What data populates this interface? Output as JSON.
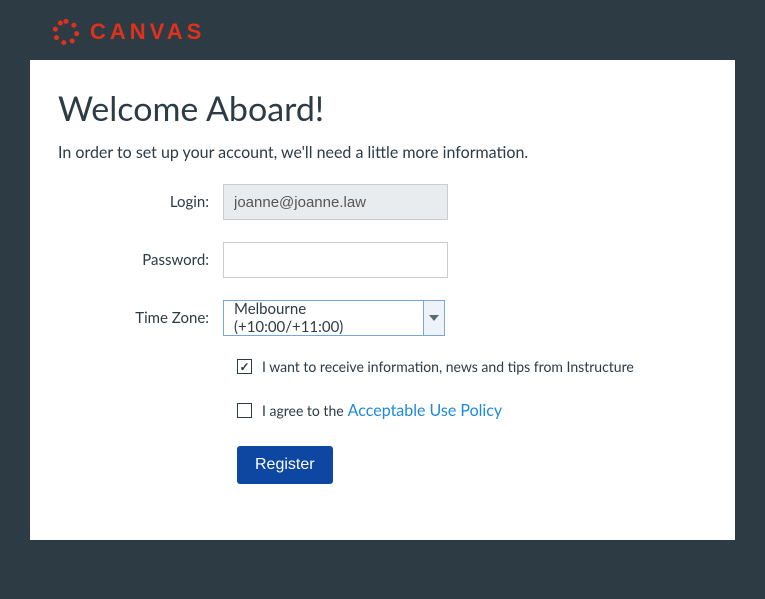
{
  "brand": "CANVAS",
  "page": {
    "title": "Welcome Aboard!",
    "subtitle": "In order to set up your account, we'll need a little more information."
  },
  "form": {
    "login_label": "Login:",
    "login_value": "joanne@joanne.law",
    "password_label": "Password:",
    "password_value": "",
    "timezone_label": "Time Zone:",
    "timezone_value": "Melbourne (+10:00/+11:00)"
  },
  "checkboxes": {
    "news": {
      "checked": true,
      "label": "I want to receive information, news and tips from Instructure"
    },
    "policy": {
      "checked": false,
      "prefix": "I agree to the",
      "link_text": "Acceptable Use Policy"
    }
  },
  "buttons": {
    "register": "Register"
  }
}
